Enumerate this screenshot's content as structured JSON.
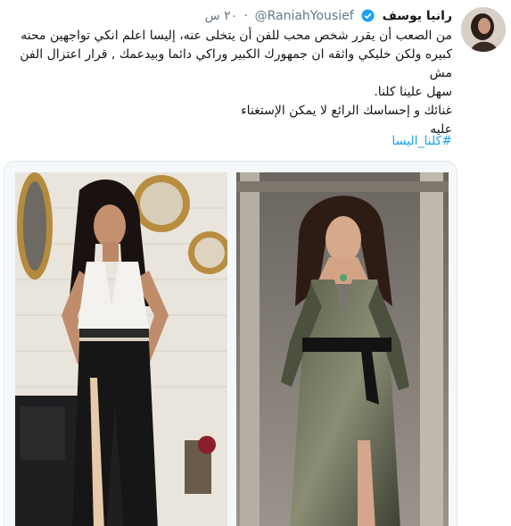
{
  "tweet": {
    "author_name": "رانيا يوسف",
    "handle": "@RaniahYousief",
    "time": "٢٠ س",
    "text_lines": [
      "من الصعب أن يقرر شخص محب للفن أن يتخلى عنه، إليسا اعلم انكي تواجهين محنه",
      "كبيره ولكن خليكي واثقه ان جمهورك الكبير وراكي دائما وبيدعمك , قرار اعتزال الفن مش",
      "سهل علينا كلنا.",
      "غنائك و إحساسك الرائع  لا يمكن الإستغناء",
      "عليه"
    ],
    "hashtag": "#كلنا_اليسا"
  },
  "icons": {
    "verified": "verified-badge-icon"
  },
  "colors": {
    "link": "#1da1f2",
    "secondary_text": "#657786",
    "border": "#e1e8ed"
  }
}
